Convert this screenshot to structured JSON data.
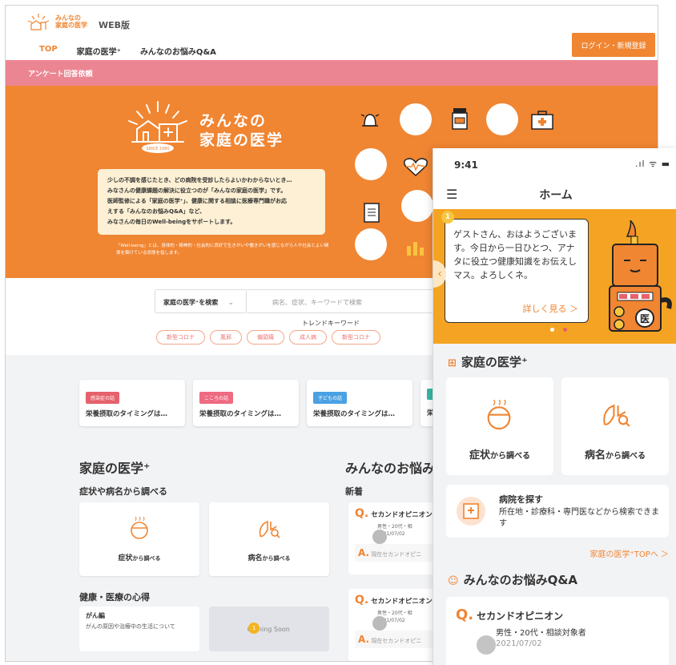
{
  "web": {
    "logo_lines": [
      "みんなの",
      "家庭の医学"
    ],
    "version_label": "WEB版",
    "login_button": "ログイン・新規登録",
    "nav": [
      {
        "label": "TOP"
      },
      {
        "label": "家庭の医学⁺"
      },
      {
        "label": "みんなのお悩みQ&A"
      }
    ],
    "survey_bar": "アンケート回答依頼",
    "hero": {
      "title_line1": "みんなの",
      "title_line2": "家庭の医学",
      "since": "SINCE 1980",
      "desc_lines": [
        "少しの不調を感じたとき、どの病院を受診したらよいかわからないとき…",
        "みなさんの健康課題の解決に役立つのが「みんなの家庭の医学」です。",
        "医師監修による「家庭の医学⁺」、健康に関する相談に医療専門職がお応",
        "えする「みんなのお悩みQ&A」など、",
        "みなさんの毎日のWell-beingをサポートします。"
      ],
      "note": "「Well-being」とは、身体的・精神的・社会的に良好で生きがいや働きがいを感じながら人や社会とよい関係を築けている状態を指します。"
    },
    "search": {
      "select_label": "家庭の医学⁺を検索",
      "placeholder": "病名、症状、キーワードで検索",
      "trend_label": "トレンドキーワード",
      "trends": [
        "新型コロナ",
        "風邪",
        "偏頭痛",
        "成人病",
        "新型コロナ"
      ]
    },
    "cards": [
      {
        "tag": "感染症の話",
        "title": "栄養摂取のタイミングは…",
        "color": "#e5616b"
      },
      {
        "tag": "こころの話",
        "title": "栄養摂取のタイミングは…",
        "color": "#ee6b81"
      },
      {
        "tag": "子どもの話",
        "title": "栄養摂取のタイミングは…",
        "color": "#4aa1e3"
      },
      {
        "tag": "",
        "title": "栄養",
        "color": "#36b8a6"
      }
    ],
    "medicine_section": {
      "title": "家庭の医学⁺",
      "sub": "症状や病名から調べる",
      "tile1_main": "症状",
      "tile1_small": "から調べる",
      "tile2_main": "病名",
      "tile2_small": "から調べる",
      "health_title": "健康・医療の心得",
      "cancer_title": "がん編",
      "cancer_desc": "がんの原因や治療中の生活について",
      "coming_soon": "Coming Soon",
      "coming_badge": "1"
    },
    "qa_section": {
      "title": "みんなのお悩み",
      "new_label": "新着",
      "items": [
        {
          "q": "セカンドオピニオン",
          "meta1": "男性・20代・相",
          "meta2": "2021/07/02",
          "a": "現在セカンドオピニ"
        },
        {
          "q": "セカンドオピニオン",
          "meta1": "男性・20代・相",
          "meta2": "2021/07/02",
          "a": "現在セカンドオピニ"
        }
      ]
    }
  },
  "phone": {
    "time": "9:41",
    "status_icons": ".ıl ᯤ ▬",
    "header_title": "ホーム",
    "banner": {
      "number": "1",
      "message": "ゲストさん、おはようございます。今日から一日ひとつ、アナタに役立つ健康知識をお伝えしマス。よろしくネ。",
      "more_link": "詳しく見る ＞",
      "robot_badge": "医"
    },
    "medicine": {
      "title": "家庭の医学⁺",
      "tile1_main": "症状",
      "tile1_small": "から調べる",
      "tile2_main": "病名",
      "tile2_small": "から調べる",
      "hospital_title": "病院を探す",
      "hospital_desc": "所在地・診療科・専門医などから検索できます",
      "top_link": "家庭の医学⁺TOPへ ＞"
    },
    "qa": {
      "title": "みんなのお悩みQ&A",
      "question": "セカンドオピニオン",
      "meta1": "男性・20代・相談対象者",
      "meta2": "2021/07/02"
    }
  },
  "colors": {
    "brand_orange": "#f08532",
    "survey_pink": "#ec8592",
    "banner_yellow": "#f4a422"
  }
}
